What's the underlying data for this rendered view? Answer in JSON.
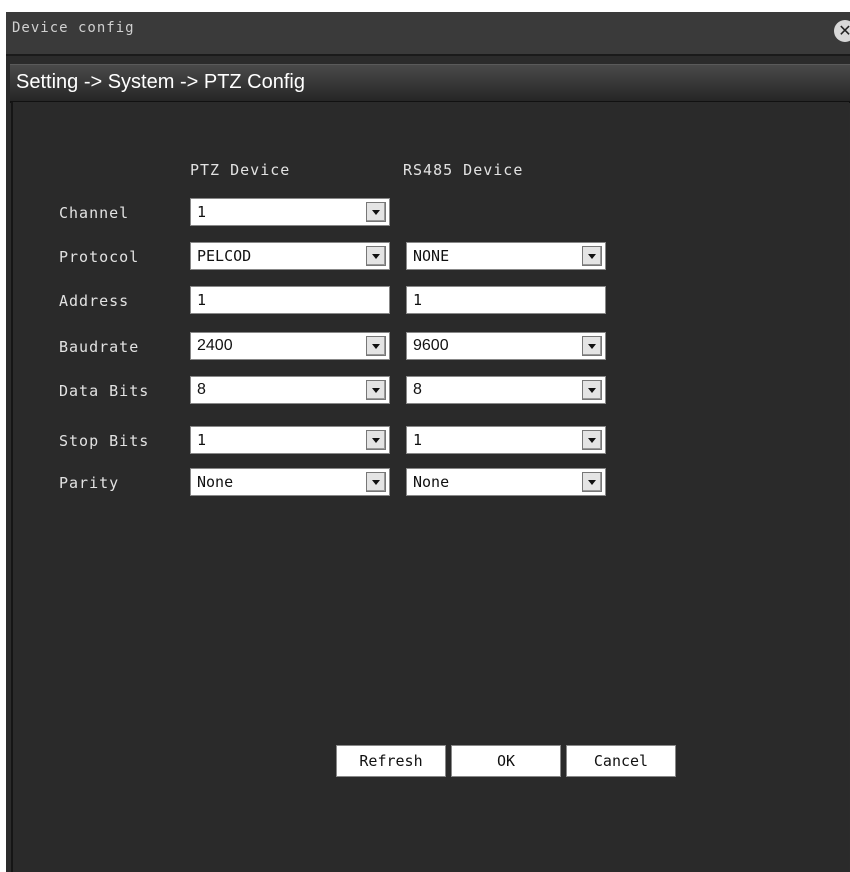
{
  "window": {
    "title": "Device config",
    "close_icon": "close-icon"
  },
  "breadcrumb": "Setting -> System -> PTZ Config",
  "columns": {
    "ptz": "PTZ Device",
    "rs485": "RS485 Device"
  },
  "rows": [
    {
      "label": "Channel",
      "ptz": "1",
      "rs485": null
    },
    {
      "label": "Protocol",
      "ptz": "PELCOD",
      "rs485": "NONE"
    },
    {
      "label": "Address",
      "ptz": "1",
      "rs485": "1"
    },
    {
      "label": "Baudrate",
      "ptz": "2400",
      "rs485": "9600"
    },
    {
      "label": "Data Bits",
      "ptz": "8",
      "rs485": "8"
    },
    {
      "label": "Stop Bits",
      "ptz": "1",
      "rs485": "1"
    },
    {
      "label": "Parity",
      "ptz": "None",
      "rs485": "None"
    }
  ],
  "buttons": {
    "refresh": "Refresh",
    "ok": "OK",
    "cancel": "Cancel"
  }
}
